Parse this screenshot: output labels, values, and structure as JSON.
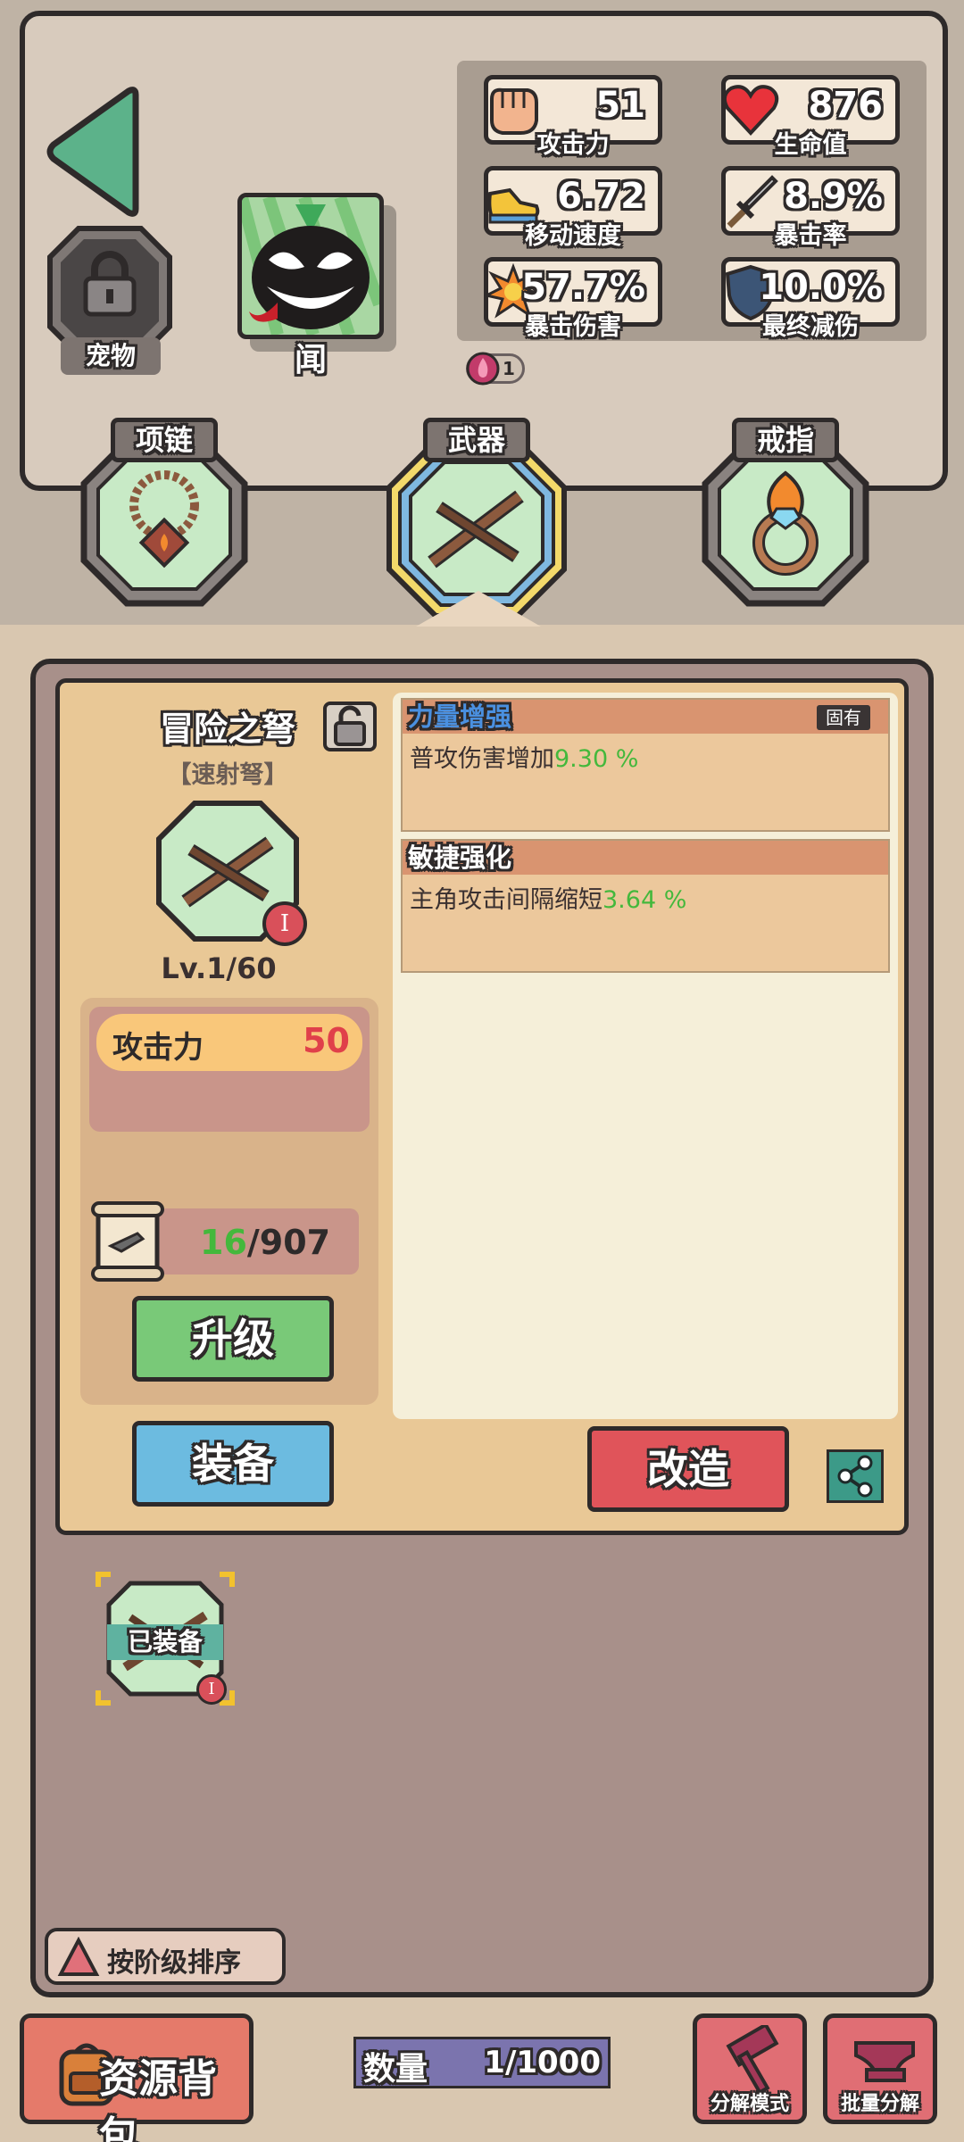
{
  "hero": {
    "pet_label": "宠物",
    "character_name": "闻",
    "badge_count": "1"
  },
  "stats": [
    {
      "value": "51",
      "label": "攻击力",
      "icon": "fist-icon"
    },
    {
      "value": "876",
      "label": "生命值",
      "icon": "heart-icon"
    },
    {
      "value": "6.72",
      "label": "移动速度",
      "icon": "shoe-icon"
    },
    {
      "value": "8.9%",
      "label": "暴击率",
      "icon": "sword-icon"
    },
    {
      "value": "57.7%",
      "label": "暴击伤害",
      "icon": "explosion-icon"
    },
    {
      "value": "10.0%",
      "label": "最终减伤",
      "icon": "shield-icon"
    }
  ],
  "equip_slots": [
    {
      "label": "项链",
      "icon": "necklace-icon"
    },
    {
      "label": "武器",
      "icon": "crossbow-icon"
    },
    {
      "label": "戒指",
      "icon": "ring-icon"
    }
  ],
  "item": {
    "name": "冒险之弩",
    "type": "【速射弩】",
    "level": "Lv.1/60",
    "grade": "I",
    "attack_label": "攻击力",
    "attack_value": "50",
    "material_have": "16",
    "material_need": "/907",
    "upgrade_label": "升级",
    "equip_label": "装备",
    "reforge_label": "改造"
  },
  "attributes": [
    {
      "title": "力量增强",
      "tag": "固有",
      "desc": "普攻伤害增加",
      "value": "9.30 %"
    },
    {
      "title": "敏捷强化",
      "tag": "",
      "desc": "主角攻击间隔缩短",
      "value": "3.64 %"
    }
  ],
  "inventory": {
    "equipped_label": "已装备",
    "grade": "I",
    "sort_label": "按阶级排序"
  },
  "bottom_bar": {
    "resource_bag": "资源背包",
    "count_label": "数量",
    "count_value": "1/1000",
    "decompose_mode": "分解模式",
    "batch_decompose": "批量分解"
  },
  "colors": {
    "accent_green": "#44b83c",
    "attack_red": "#e0404a",
    "upgrade_green": "#79c978",
    "equip_blue": "#6cbbe0",
    "reforge_red": "#e0545a"
  }
}
